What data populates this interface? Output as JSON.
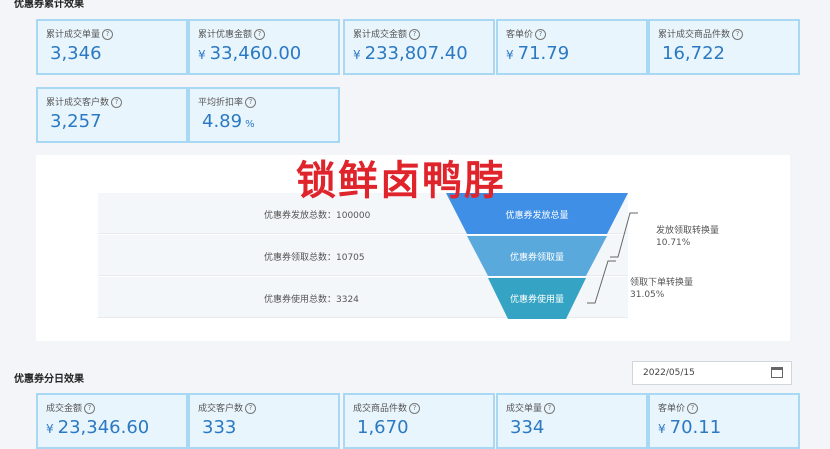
{
  "top_section": {
    "title": "优惠券累计效果"
  },
  "top_cards": [
    {
      "label": "累计成交单量",
      "currency": "",
      "value": "3,346",
      "unit": ""
    },
    {
      "label": "累计优惠金额",
      "currency": "¥",
      "value": "33,460.00",
      "unit": ""
    },
    {
      "label": "累计成交金额",
      "currency": "¥",
      "value": "233,807.40",
      "unit": ""
    },
    {
      "label": "客单价",
      "currency": "¥",
      "value": "71.79",
      "unit": ""
    },
    {
      "label": "累计成交商品件数",
      "currency": "",
      "value": "16,722",
      "unit": ""
    },
    {
      "label": "累计成交客户数",
      "currency": "",
      "value": "3,257",
      "unit": ""
    },
    {
      "label": "平均折扣率",
      "currency": "",
      "value": "4.89",
      "unit": "%"
    }
  ],
  "info_glyph": "?",
  "watermark": "锁鲜卤鸭脖",
  "funnel": {
    "rows": [
      {
        "text": "优惠券发放总数：100000",
        "stage": "优惠券发放总量",
        "color": "#3f8fe6"
      },
      {
        "text": "优惠券领取总数：10705",
        "stage": "优惠券领取量",
        "color": "#5aa9dd"
      },
      {
        "text": "优惠券使用总数：3324",
        "stage": "优惠券使用量",
        "color": "#35a4c4"
      }
    ],
    "conversions": [
      {
        "label": "发放领取转换量",
        "value": "10.71%"
      },
      {
        "label": "领取下单转换量",
        "value": "31.05%"
      }
    ]
  },
  "daily_section": {
    "title": "优惠券分日效果",
    "date": "2022/05/15"
  },
  "daily_cards": [
    {
      "label": "成交金额",
      "currency": "¥",
      "value": "23,346.60",
      "unit": ""
    },
    {
      "label": "成交客户数",
      "currency": "",
      "value": "333",
      "unit": ""
    },
    {
      "label": "成交商品件数",
      "currency": "",
      "value": "1,670",
      "unit": ""
    },
    {
      "label": "成交单量",
      "currency": "",
      "value": "334",
      "unit": ""
    },
    {
      "label": "客单价",
      "currency": "¥",
      "value": "70.11",
      "unit": ""
    }
  ]
}
